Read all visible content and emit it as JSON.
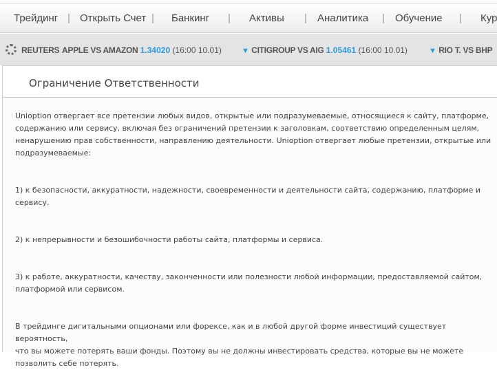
{
  "nav": {
    "items": [
      "Трейдинг",
      "Открыть Счет",
      "Банкинг",
      "Активы",
      "Аналитика",
      "Обучение",
      "Кур"
    ]
  },
  "ticker": {
    "brand": "REUTERS",
    "items": [
      {
        "name": "APPLE VS AMAZON",
        "value": "1.34020",
        "time": "(16:00 10.01)"
      },
      {
        "name": "CITIGROUP VS AIG",
        "value": "1.05461",
        "time": "(16:00 10.01)"
      },
      {
        "name": "RIO T. VS BHP"
      }
    ]
  },
  "page": {
    "title": "Ограничение Ответственности",
    "paragraphs": [
      [
        "Unioption отвергает все претензии любых видов, открытые или подразумеваемые, относящиеся к сайту, платформе,",
        "содержанию или сервису, включая без ограничений претензии к заголовкам, соответствию определенным целям,",
        "ненарушению прав собственности, направлению деятельности. Unioption отвергает любые претензии, открытые или",
        "подразумеваемые:"
      ],
      [
        "1) к безопасности, аккуратности, надежности, своевременности и деятельности сайта, содержанию, платформе  и",
        "сервису."
      ],
      [
        "2) к непрерывности и безошибочности работы сайта, платформы и сервиса."
      ],
      [
        "3) к работе, аккуратности, качеству, законченности или полезности любой информации, предоставляемой сайтом,",
        "платформой или сервисом."
      ],
      [
        "В трейдинге дигитальными опционами или форексе, как и в любой другой форме инвестиций существует вероятность,",
        "что вы можете потерять ваши фонды. Поэтому вы не должны инвестировать средства, которые вы не можете",
        "позволить себе потерять."
      ]
    ]
  }
}
